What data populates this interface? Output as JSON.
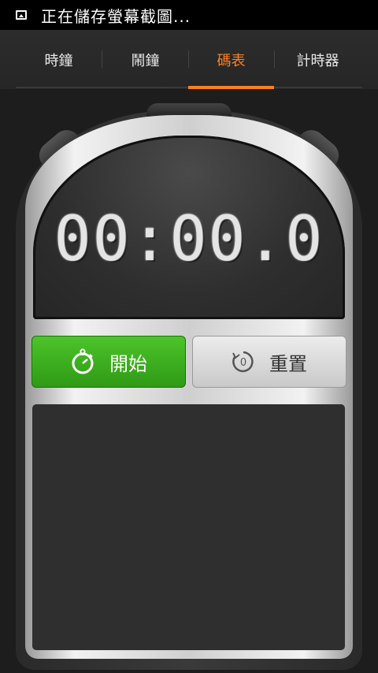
{
  "status_bar": {
    "text": "正在儲存螢幕截圖..."
  },
  "tabs": [
    {
      "label": "時鐘"
    },
    {
      "label": "鬧鐘"
    },
    {
      "label": "碼表",
      "active": true
    },
    {
      "label": "計時器"
    }
  ],
  "accent_color": "#ff7f1f",
  "display": {
    "time": "00:00.0"
  },
  "buttons": {
    "start": {
      "label": "開始",
      "icon": "stopwatch-icon",
      "color": "#3fb021"
    },
    "reset": {
      "label": "重置",
      "icon": "reset-icon"
    }
  }
}
